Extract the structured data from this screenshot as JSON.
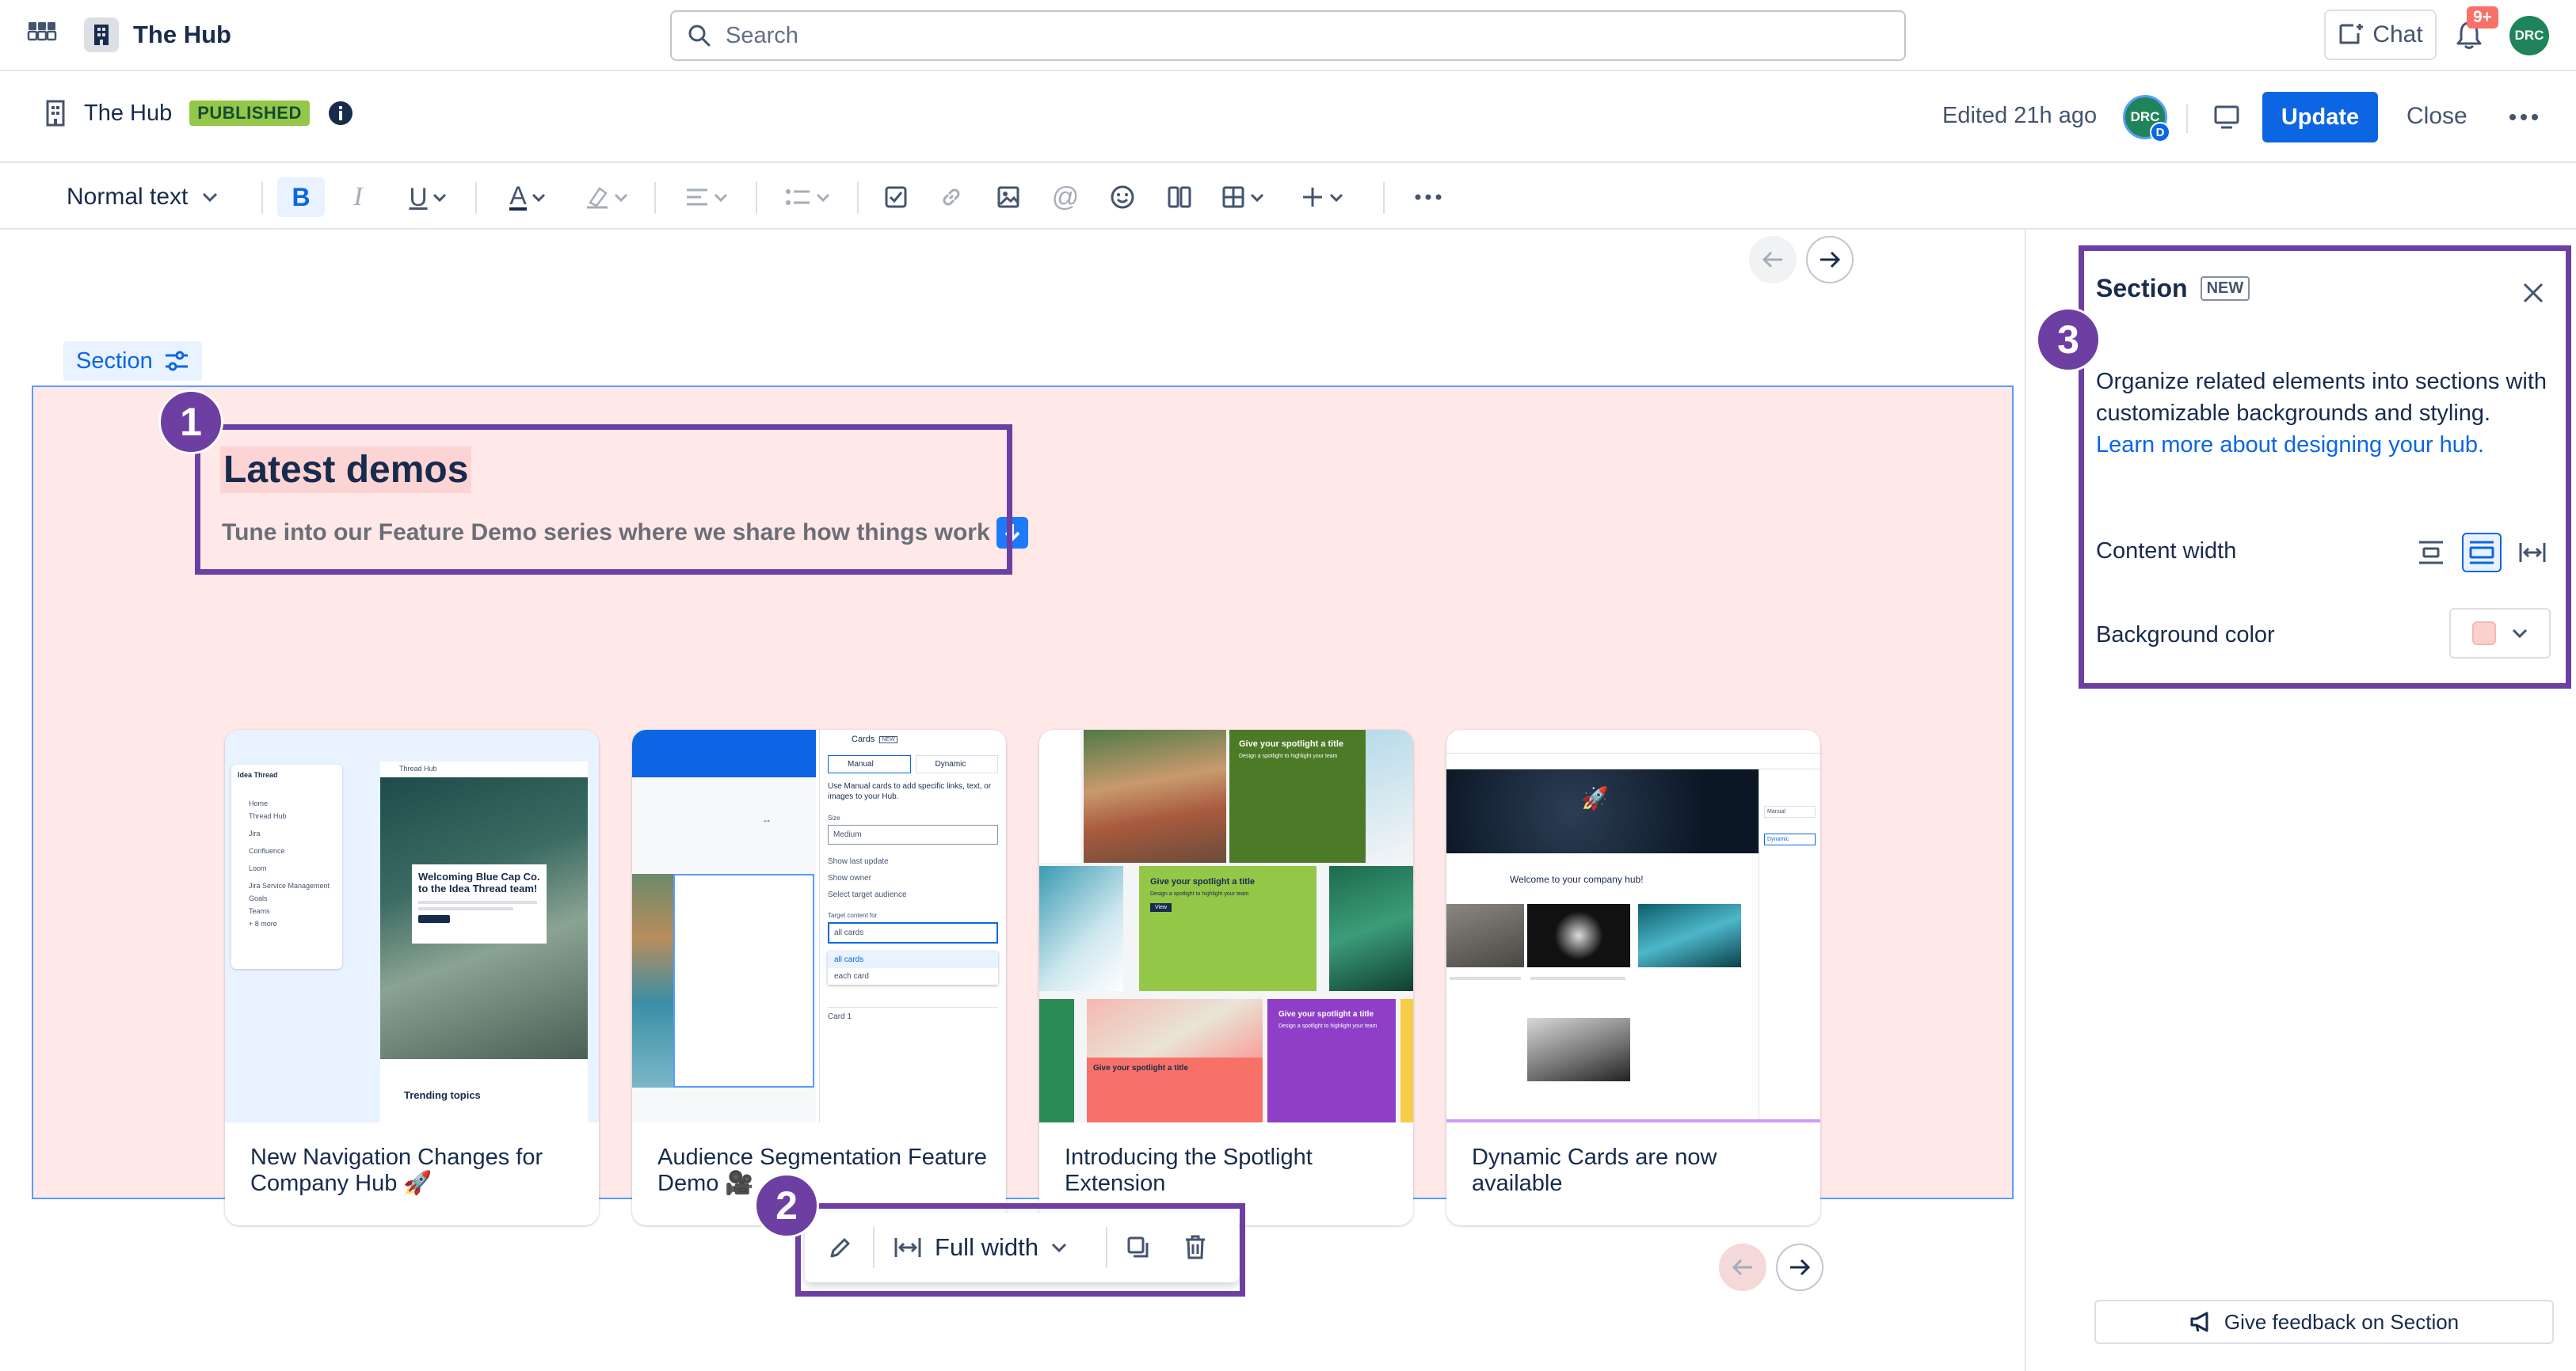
{
  "topbar": {
    "app_name": "The Hub",
    "search_placeholder": "Search",
    "chat_label": "Chat",
    "notification_count": "9+",
    "user_initials": "DRC"
  },
  "page_header": {
    "space_name": "The Hub",
    "status": "PUBLISHED",
    "edited": "Edited 21h ago",
    "avatar_initials": "DRC",
    "avatar_sub": "D",
    "update_label": "Update",
    "close_label": "Close"
  },
  "toolbar": {
    "text_style": "Normal text"
  },
  "section_tag": "Section",
  "heading": "Latest demos",
  "subheading": "Tune into our Feature Demo series where we share how things work",
  "cards": [
    {
      "title": "New Navigation Changes for Company Hub 🚀"
    },
    {
      "title": "Audience Segmentation Feature Demo 🎥"
    },
    {
      "title": "Introducing the Spotlight Extension"
    },
    {
      "title": "Dynamic Cards are now available"
    }
  ],
  "thumbs": {
    "nav": {
      "sidebar_title": "Idea Thread",
      "items": [
        "Home",
        "Thread Hub",
        "Jira",
        "Confluence",
        "Loom",
        "Jira Service Management",
        "Goals",
        "Teams",
        "+ 8 more"
      ],
      "topbar": "Thread Hub",
      "welcome": "Welcoming Blue Cap Co. to the Idea Thread team!",
      "trending": "Trending topics"
    },
    "audience": {
      "panel_title": "Cards",
      "badge": "NEW",
      "opt_manual": "Manual",
      "opt_dynamic": "Dynamic",
      "desc": "Use Manual cards to add specific links, text, or images to your Hub.",
      "size_label": "Size",
      "size_value": "Medium",
      "toggle1": "Show last update",
      "toggle2": "Show owner",
      "toggle3": "Select target audience",
      "target_label": "Target content for",
      "target_value": "all cards",
      "opt1": "all cards",
      "opt2": "each card",
      "card1": "Card 1"
    },
    "spotlight": {
      "tile_title": "Give your spotlight a title",
      "tile_text": "Design a spotlight to highlight your team",
      "view": "View"
    },
    "dynamic": {
      "welcome": "Welcome to your company hub!",
      "manual": "Manual",
      "dynamic": "Dynamic"
    }
  },
  "float_toolbar": {
    "width_label": "Full width"
  },
  "panel": {
    "title": "Section",
    "badge": "NEW",
    "desc": "Organize related elements into sections with customizable backgrounds and styling.",
    "link": "Learn more about designing your hub.",
    "content_width_label": "Content width",
    "bg_color_label": "Background color",
    "bg_color_value": "#fdd0d0",
    "feedback_label": "Give feedback on Section"
  },
  "callouts": [
    "1",
    "2",
    "3"
  ],
  "colors": {
    "accent": "#0c66e4",
    "callout": "#6e3fa3",
    "section_bg": "#fee8e8",
    "published": "#94c748"
  }
}
